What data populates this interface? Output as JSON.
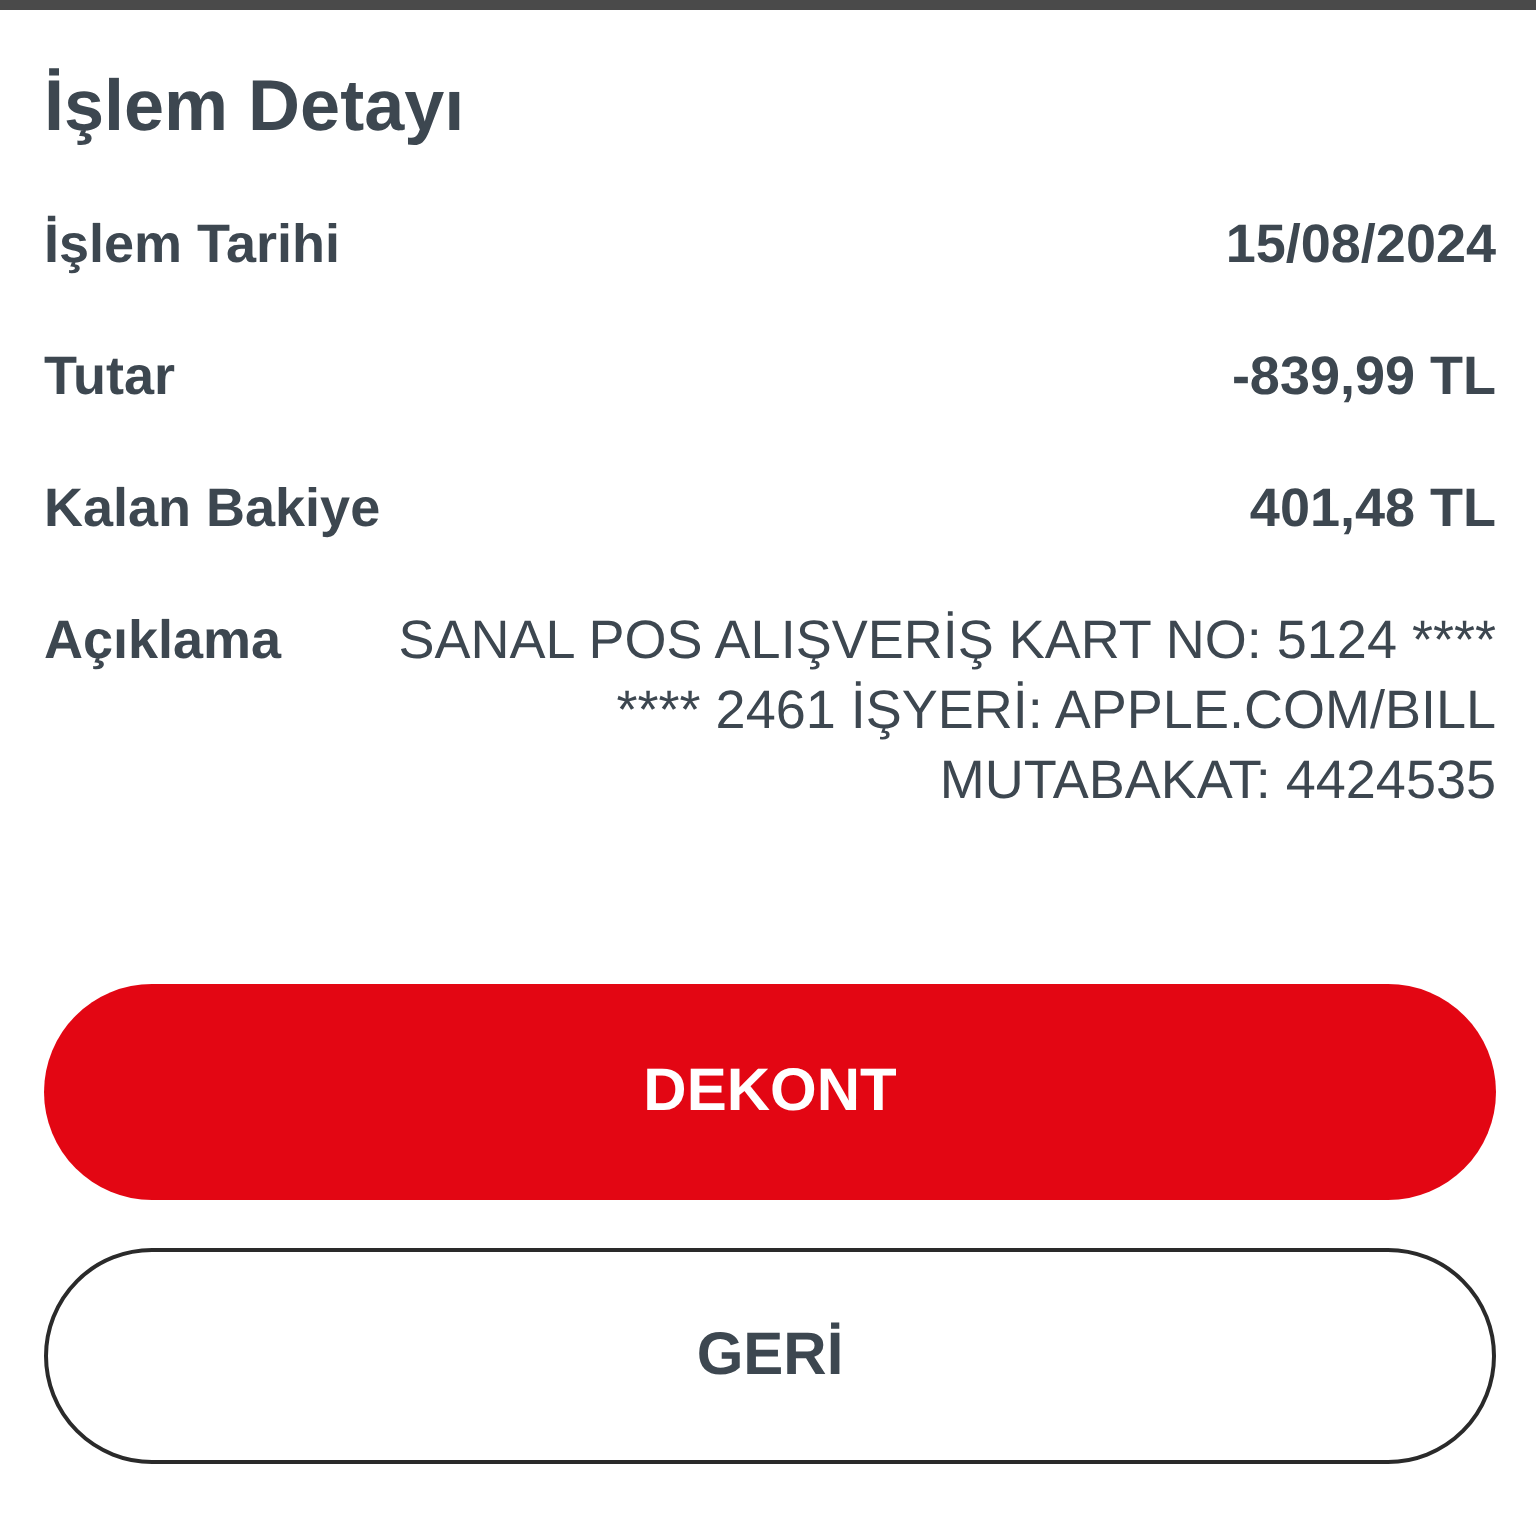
{
  "title": "İşlem Detayı",
  "details": [
    {
      "label": "İşlem Tarihi",
      "value": "15/08/2024",
      "kind": "bold"
    },
    {
      "label": "Tutar",
      "value": "-839,99 TL",
      "kind": "bold"
    },
    {
      "label": "Kalan Bakiye",
      "value": "401,48 TL",
      "kind": "bold"
    },
    {
      "label": "Açıklama",
      "value": "SANAL POS ALIŞVERİŞ KART NO: 5124 **** **** 2461 İŞYERİ: APPLE.COM/BILL MUTABAKAT: 4424535",
      "kind": "plain"
    }
  ],
  "buttons": [
    {
      "label": "DEKONT",
      "kind": "primary"
    },
    {
      "label": "GERİ",
      "kind": "secondary"
    }
  ]
}
